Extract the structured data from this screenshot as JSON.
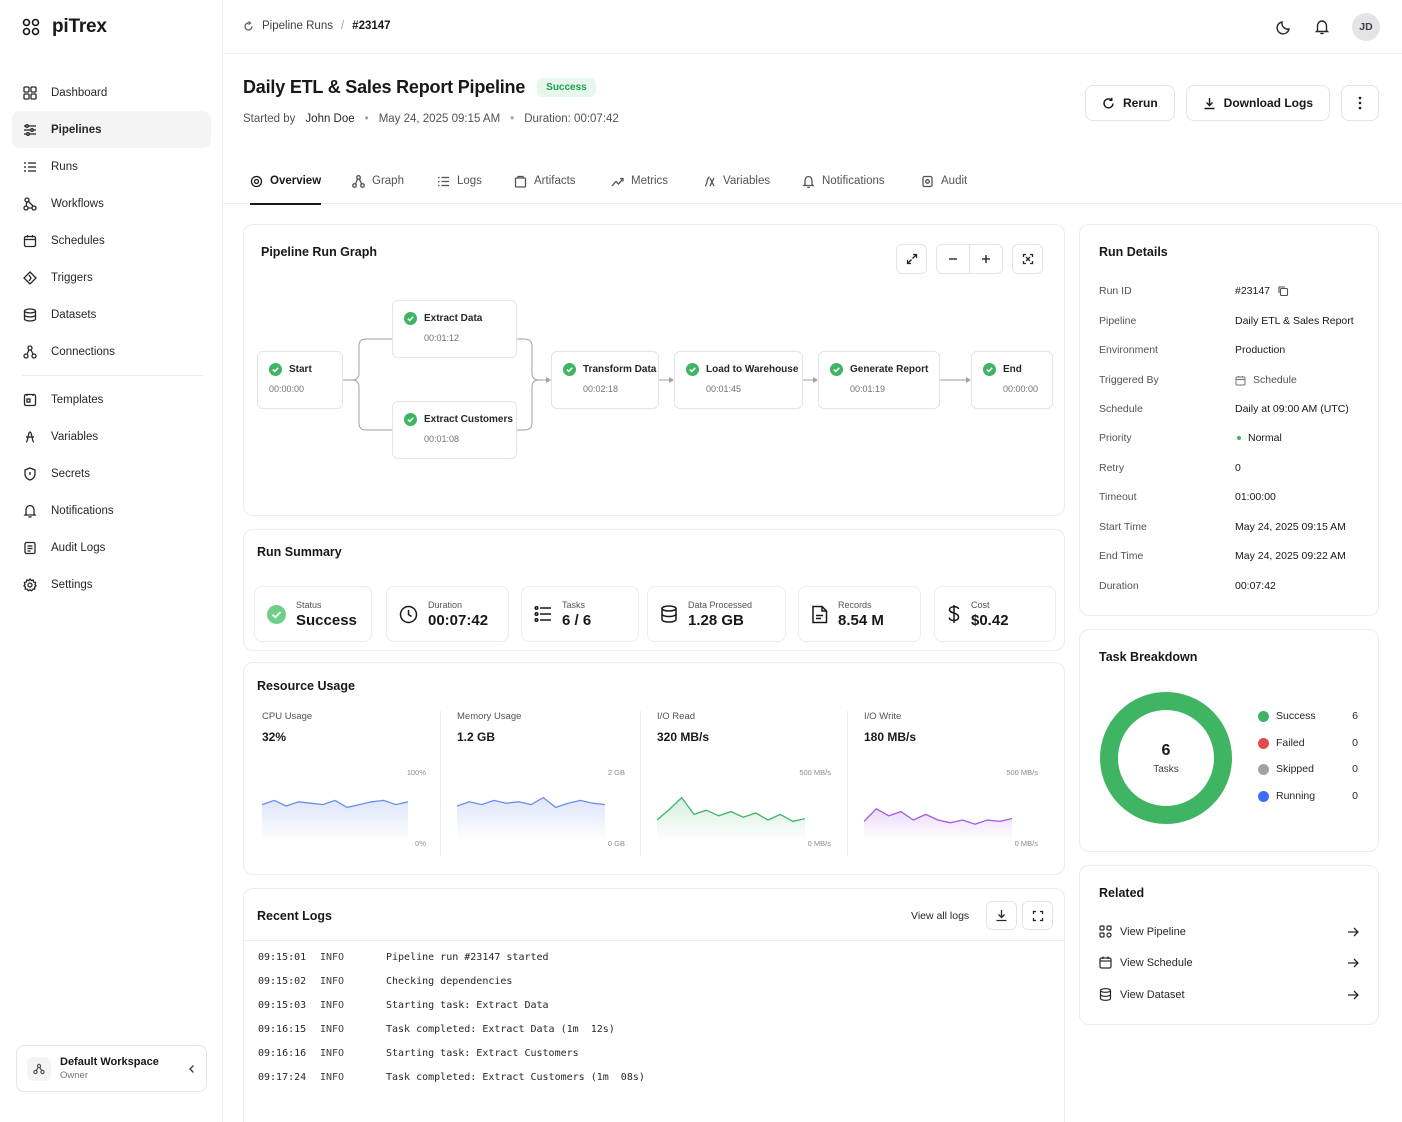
{
  "app": {
    "name": "piTrex"
  },
  "sidebar": {
    "items": [
      {
        "label": "Dashboard",
        "icon": "dashboard-icon"
      },
      {
        "label": "Pipelines",
        "icon": "pipelines-icon",
        "active": true
      },
      {
        "label": "Runs",
        "icon": "runs-icon"
      },
      {
        "label": "Workflows",
        "icon": "workflows-icon"
      },
      {
        "label": "Schedules",
        "icon": "calendar-icon"
      },
      {
        "label": "Triggers",
        "icon": "trigger-icon"
      },
      {
        "label": "Datasets",
        "icon": "database-icon"
      },
      {
        "label": "Connections",
        "icon": "connections-icon"
      }
    ],
    "items2": [
      {
        "label": "Templates",
        "icon": "templates-icon"
      },
      {
        "label": "Variables",
        "icon": "variables-icon"
      },
      {
        "label": "Secrets",
        "icon": "secrets-icon"
      },
      {
        "label": "Notifications",
        "icon": "bell-icon"
      },
      {
        "label": "Audit Logs",
        "icon": "audit-icon"
      },
      {
        "label": "Settings",
        "icon": "gear-icon"
      }
    ],
    "workspace": {
      "name": "Default Workspace",
      "role": "Owner"
    }
  },
  "header": {
    "breadcrumb": {
      "parent": "Pipeline Runs",
      "current": "#23147"
    },
    "avatar_initials": "JD"
  },
  "page": {
    "title": "Daily ETL & Sales Report Pipeline",
    "status": "Success",
    "started_by_label": "Started by",
    "started_by": "John Doe",
    "started_at": "May 24, 2025 09:15 AM",
    "duration_text": "Duration: 00:07:42",
    "rerun_label": "Rerun",
    "download_label": "Download Logs"
  },
  "tabs": [
    "Overview",
    "Graph",
    "Logs",
    "Artifacts",
    "Metrics",
    "Variables",
    "Notifications",
    "Audit"
  ],
  "graph": {
    "title": "Pipeline Run Graph",
    "nodes": [
      {
        "name": "Start",
        "time": "00:00:00"
      },
      {
        "name": "Extract Data",
        "time": "00:01:12"
      },
      {
        "name": "Extract Customers",
        "time": "00:01:08"
      },
      {
        "name": "Transform Data",
        "time": "00:02:18"
      },
      {
        "name": "Load to Warehouse",
        "time": "00:01:45"
      },
      {
        "name": "Generate Report",
        "time": "00:01:19"
      },
      {
        "name": "End",
        "time": "00:00:00"
      }
    ]
  },
  "summary": {
    "title": "Run Summary",
    "stats": [
      {
        "label": "Status",
        "value": "Success"
      },
      {
        "label": "Duration",
        "value": "00:07:42"
      },
      {
        "label": "Tasks",
        "value": "6 / 6"
      },
      {
        "label": "Data Processed",
        "value": "1.28 GB"
      },
      {
        "label": "Records",
        "value": "8.54 M"
      },
      {
        "label": "Cost",
        "value": "$0.42"
      }
    ]
  },
  "resources": {
    "title": "Resource Usage",
    "items": [
      {
        "label": "CPU Usage",
        "value": "32%",
        "max": "100%",
        "min": "0%",
        "color": "#6b8df0",
        "series": [
          52,
          58,
          50,
          56,
          54,
          52,
          58,
          48,
          52,
          56,
          58,
          52,
          56
        ]
      },
      {
        "label": "Memory Usage",
        "value": "1.2 GB",
        "max": "2 GB",
        "min": "0 GB",
        "color": "#6b8df0",
        "series": [
          50,
          56,
          52,
          58,
          54,
          56,
          52,
          62,
          48,
          54,
          58,
          54,
          52
        ]
      },
      {
        "label": "I/O Read",
        "value": "320 MB/s",
        "max": "500 MB/s",
        "min": "0 MB/s",
        "color": "#3fb463",
        "series": [
          30,
          45,
          62,
          38,
          44,
          36,
          42,
          34,
          40,
          30,
          38,
          28,
          32
        ]
      },
      {
        "label": "I/O Write",
        "value": "180 MB/s",
        "max": "500 MB/s",
        "min": "0 MB/s",
        "color": "#a25ae6",
        "series": [
          28,
          46,
          36,
          42,
          30,
          38,
          30,
          26,
          30,
          24,
          30,
          28,
          32
        ]
      }
    ]
  },
  "logs": {
    "title": "Recent Logs",
    "view_all": "View all logs",
    "rows": [
      {
        "time": "09:15:01",
        "level": "INFO",
        "msg": "Pipeline run #23147 started"
      },
      {
        "time": "09:15:02",
        "level": "INFO",
        "msg": "Checking dependencies"
      },
      {
        "time": "09:15:03",
        "level": "INFO",
        "msg": "Starting task: Extract Data"
      },
      {
        "time": "09:16:15",
        "level": "INFO",
        "msg": "Task completed: Extract Data (1m  12s)"
      },
      {
        "time": "09:16:16",
        "level": "INFO",
        "msg": "Starting task: Extract Customers"
      },
      {
        "time": "09:17:24",
        "level": "INFO",
        "msg": "Task completed: Extract Customers (1m  08s)"
      }
    ]
  },
  "details": {
    "title": "Run Details",
    "rows": [
      {
        "k": "Run ID",
        "v": "#23147"
      },
      {
        "k": "Pipeline",
        "v": "Daily ETL & Sales Report"
      },
      {
        "k": "Environment",
        "v": "Production"
      },
      {
        "k": "Triggered By",
        "v": "Schedule"
      },
      {
        "k": "Schedule",
        "v": "Daily at 09:00 AM (UTC)"
      },
      {
        "k": "Priority",
        "v": "Normal"
      },
      {
        "k": "Retry",
        "v": "0"
      },
      {
        "k": "Timeout",
        "v": "01:00:00"
      },
      {
        "k": "Start Time",
        "v": "May 24, 2025 09:15 AM"
      },
      {
        "k": "End Time",
        "v": "May 24, 2025 09:22 AM"
      },
      {
        "k": "Duration",
        "v": "00:07:42"
      }
    ]
  },
  "breakdown": {
    "title": "Task Breakdown",
    "center_value": "6",
    "center_label": "Tasks",
    "items": [
      {
        "label": "Success",
        "count": "6",
        "color": "#3fb463"
      },
      {
        "label": "Failed",
        "count": "0",
        "color": "#e5484d"
      },
      {
        "label": "Skipped",
        "count": "0",
        "color": "#a1a1aa"
      },
      {
        "label": "Running",
        "count": "0",
        "color": "#3b6ff5"
      }
    ]
  },
  "related": {
    "title": "Related",
    "items": [
      {
        "label": "View Pipeline",
        "icon": "workflow-icon"
      },
      {
        "label": "View Schedule",
        "icon": "calendar-icon"
      },
      {
        "label": "View Dataset",
        "icon": "database-icon"
      }
    ]
  },
  "colors": {
    "success": "#3fb463",
    "accent": "#18181b"
  }
}
